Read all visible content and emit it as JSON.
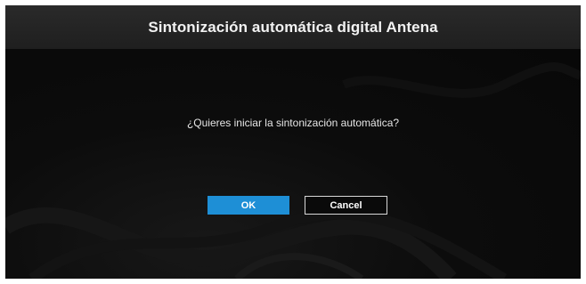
{
  "dialog": {
    "title": "Sintonización automática digital Antena",
    "message": "¿Quieres iniciar la sintonización automática?",
    "ok_label": "OK",
    "cancel_label": "Cancel"
  },
  "colors": {
    "header_bg": "#232323",
    "body_bg": "#0a0a0a",
    "ok_bg": "#1e8fd6",
    "cancel_border": "#d8d8d8",
    "text": "#f2f2f2"
  }
}
